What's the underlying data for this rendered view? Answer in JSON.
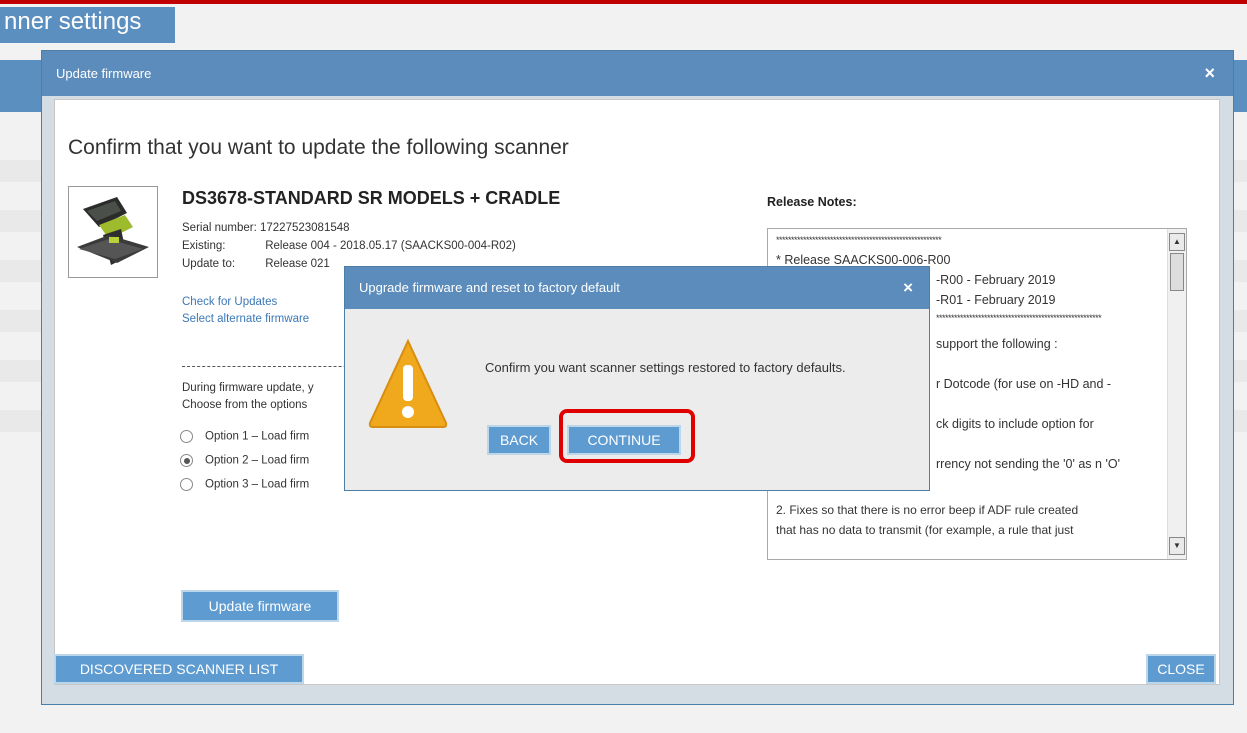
{
  "background": {
    "tab_label": "nner settings"
  },
  "dialog": {
    "title": "Update firmware",
    "close_glyph": "×",
    "heading": "Confirm that you want to update the following scanner",
    "scanner": {
      "model": "DS3678-STANDARD SR MODELS + CRADLE",
      "serial_label": "Serial number:",
      "serial_value": "17227523081548",
      "existing_label": "Existing:",
      "existing_value": "Release 004 - 2018.05.17 (SAACKS00-004-R02)",
      "update_label": "Update to:",
      "update_value": "Release 021"
    },
    "links": {
      "check_updates": "Check for Updates",
      "select_alternate": "Select alternate firmware"
    },
    "during_text": "During firmware update, y",
    "choose_text": "Choose from the options",
    "options": [
      {
        "label": "Option 1 – Load firm",
        "selected": false
      },
      {
        "label": "Option 2 – Load firm",
        "selected": true
      },
      {
        "label": "Option 3 – Load firm",
        "selected": false
      }
    ],
    "update_button": "Update firmware",
    "release_notes": {
      "title": "Release Notes:",
      "lines": [
        "*******************************************************",
        "* Release  SAACKS00-006-R00",
        "-R00 - February 2019",
        "-R01 - February 2019",
        "*******************************************************",
        "support the following :",
        "r Dotcode (for use on -HD and -",
        "ck digits to include option for",
        "rrency not sending the '0' as n 'O'",
        "2. Fixes so that there is no error beep if ADF rule created",
        "that has no data to transmit (for example, a rule that just"
      ]
    },
    "discovered_button": "DISCOVERED SCANNER LIST",
    "close_button": "CLOSE"
  },
  "modal": {
    "title": "Upgrade firmware and reset to factory default",
    "close_glyph": "×",
    "message": "Confirm you want scanner settings restored to factory defaults.",
    "back_button": "BACK",
    "continue_button": "CONTINUE",
    "icon": "warning-icon"
  },
  "colors": {
    "title_bar": "#5b8cbb",
    "button": "#5e9bd1",
    "highlight": "#e00000",
    "warning": "#f0a81c"
  }
}
